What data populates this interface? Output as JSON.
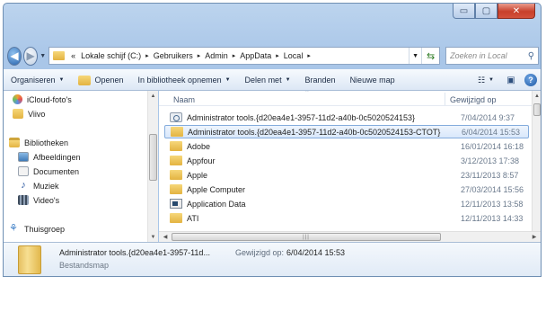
{
  "window": {
    "caption_buttons": {
      "minimize": "▭",
      "maximize": "▢",
      "close": "✕"
    }
  },
  "address": {
    "overflow": "«",
    "breadcrumbs": [
      "Lokale schijf (C:)",
      "Gebruikers",
      "Admin",
      "AppData",
      "Local"
    ],
    "separator": "▸",
    "search_placeholder": "Zoeken in Local"
  },
  "toolbar": {
    "organize": "Organiseren",
    "open": "Openen",
    "include_library": "In bibliotheek opnemen",
    "share": "Delen met",
    "burn": "Branden",
    "new_folder": "Nieuwe map"
  },
  "navpane": {
    "items": [
      {
        "label": "iCloud-foto's",
        "icon": "icloud-icon"
      },
      {
        "label": "Viivo",
        "icon": "folder-icon"
      },
      {
        "label": "Bibliotheken",
        "icon": "library-icon"
      },
      {
        "label": "Afbeeldingen",
        "icon": "pictures-icon"
      },
      {
        "label": "Documenten",
        "icon": "documents-icon"
      },
      {
        "label": "Muziek",
        "icon": "music-icon"
      },
      {
        "label": "Video's",
        "icon": "videos-icon"
      },
      {
        "label": "Thuisgroep",
        "icon": "homegroup-icon"
      }
    ]
  },
  "filelist": {
    "columns": {
      "name": "Naam",
      "date": "Gewijzigd op"
    },
    "rows": [
      {
        "name": "Administrator tools.{d20ea4e1-3957-11d2-a40b-0c5020524153}",
        "date": "7/04/2014 9:37",
        "icon": "special",
        "selected": false
      },
      {
        "name": "Administrator tools.{d20ea4e1-3957-11d2-a40b-0c5020524153-CTOT}",
        "date": "6/04/2014 15:53",
        "icon": "folder",
        "selected": true
      },
      {
        "name": "Adobe",
        "date": "16/01/2014 16:18",
        "icon": "folder",
        "selected": false
      },
      {
        "name": "Appfour",
        "date": "3/12/2013 17:38",
        "icon": "folder",
        "selected": false
      },
      {
        "name": "Apple",
        "date": "23/11/2013 8:57",
        "icon": "folder",
        "selected": false
      },
      {
        "name": "Apple Computer",
        "date": "27/03/2014 15:56",
        "icon": "folder",
        "selected": false
      },
      {
        "name": "Application Data",
        "date": "12/11/2013 13:58",
        "icon": "appdata",
        "selected": false
      },
      {
        "name": "ATI",
        "date": "12/11/2013 14:33",
        "icon": "folder",
        "selected": false
      }
    ]
  },
  "details": {
    "title": "Administrator tools.{d20ea4e1-3957-11d...",
    "modified_label": "Gewijzigd op:",
    "modified_value": "6/04/2014 15:53",
    "type": "Bestandsmap"
  }
}
